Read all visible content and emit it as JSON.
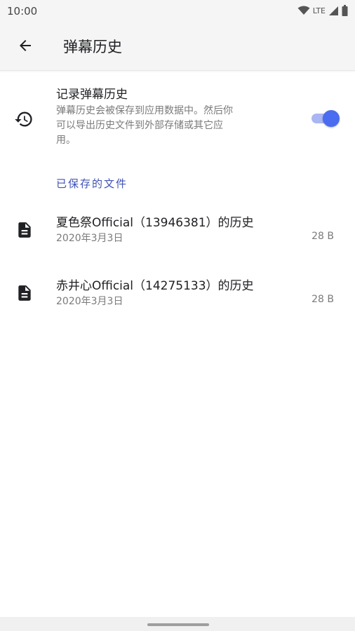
{
  "status_bar": {
    "time": "10:00",
    "network": "LTE",
    "icons": [
      "wifi-icon",
      "signal-icon",
      "battery-icon"
    ]
  },
  "app_bar": {
    "back_icon": "arrow-back-icon",
    "title": "弹幕历史"
  },
  "record_setting": {
    "icon": "history-icon",
    "title": "记录弹幕历史",
    "description_lines": [
      "弹幕历史会被保存到应用数据中。然后你",
      "可以导出历史文件到外部存储或其它应",
      "用。"
    ],
    "enabled": true,
    "accent_color": "#4a6cf0"
  },
  "saved_files": {
    "header": "已保存的文件",
    "header_color": "#3f51b5",
    "items": [
      {
        "icon": "file-document-icon",
        "name": "夏色祭Official（13946381）的历史",
        "date": "2020年3月3日",
        "size": "28 B"
      },
      {
        "icon": "file-document-icon",
        "name": "赤井心Official（14275133）的历史",
        "date": "2020年3月3日",
        "size": "28 B"
      }
    ]
  }
}
